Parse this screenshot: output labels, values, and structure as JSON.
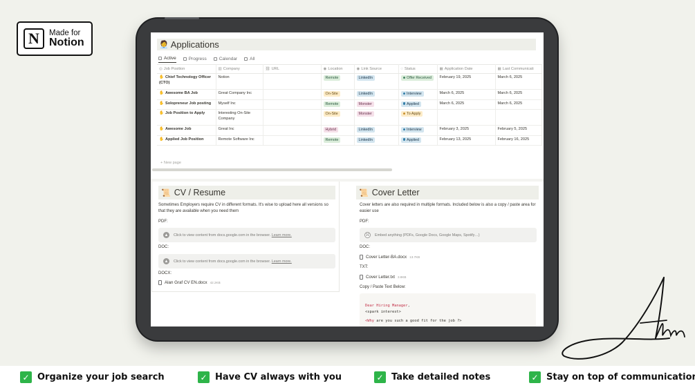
{
  "badge": {
    "line1": "Made for",
    "line2": "Notion",
    "logo_letter": "N"
  },
  "database": {
    "emoji": "🧑‍💼",
    "title": "Applications",
    "views": [
      {
        "label": "Active",
        "icon": "doc-icon",
        "active": true
      },
      {
        "label": "Progress",
        "icon": "board-icon",
        "active": false
      },
      {
        "label": "Calendar",
        "icon": "calendar-icon",
        "active": false
      },
      {
        "label": "All",
        "icon": "list-icon",
        "active": false
      }
    ],
    "columns": [
      "Job Position",
      "Company",
      "URL",
      "Location",
      "Link Source",
      "Status",
      "Application Date",
      "Last Communicati"
    ],
    "rows": [
      {
        "position": "Chief Technology Officer (CTO)",
        "company": "Notion",
        "url": "",
        "location": "Remote",
        "source": "LinkedIn",
        "status": "Offer Received",
        "applied": "February 19, 2025",
        "last": "March 6, 2025"
      },
      {
        "position": "Awesome BA Job",
        "company": "Great Company Inc",
        "url": "",
        "location": "On-Site",
        "source": "LinkedIn",
        "status": "Interview",
        "applied": "March 6, 2025",
        "last": "March 6, 2025"
      },
      {
        "position": "Solopreneur Job posting",
        "company": "Myself Inc",
        "url": "",
        "location": "Remote",
        "source": "Monster",
        "status": "Applied",
        "applied": "March 6, 2025",
        "last": "March 6, 2025"
      },
      {
        "position": "Job Position to Apply",
        "company": "Interesting On-Site Company",
        "url": "",
        "location": "On-Site",
        "source": "Monster",
        "status": "To Apply",
        "applied": "",
        "last": ""
      },
      {
        "position": "Awesome Job",
        "company": "Great Inc",
        "url": "",
        "location": "Hybrid",
        "source": "LinkedIn",
        "status": "Interview",
        "applied": "February 3, 2025",
        "last": "February 5, 2025"
      },
      {
        "position": "Applied Job Position",
        "company": "Remote Software Inc",
        "url": "",
        "location": "Remote",
        "source": "LinkedIn",
        "status": "Applied",
        "applied": "February 13, 2025",
        "last": "February 16, 2025"
      }
    ],
    "new_page": "+ New page"
  },
  "cv": {
    "emoji": "📜",
    "title": "CV / Resume",
    "description": "Sometimes Employers require CV in different formats. It's wise to upload here all versions so that they are available when you need them",
    "pdf_label": "PDF:",
    "doc_label": "DOC:",
    "docx_label": "DOCX:",
    "embed_text": "Click to view content from docs.google.com in the browser.",
    "learn_more": "Learn more.",
    "docx_file": "Alan Graf CV EN.docx",
    "docx_size": "42.2KB"
  },
  "cover": {
    "emoji": "📜",
    "title": "Cover Letter",
    "description": "Cover letters are also required in multiple formats. Included below is also a copy / paste area for easier use",
    "pdf_label": "PDF:",
    "embed_text": "Embed anything (PDFs, Google Docs, Google Maps, Spotify…)",
    "doc_label": "DOC:",
    "doc_file": "Cover Letter-BA.docx",
    "doc_size": "13.7KB",
    "txt_label": "TXT:",
    "txt_file": "Cover Letter.txt",
    "txt_size": "3.8KB",
    "paste_label": "Copy / Paste Text Below:",
    "code_line1_tag": "Dear Hiring Manager",
    "code_line1_rest": ",",
    "code_line2": "<spark interest>",
    "code_line3_tag": "<Why",
    "code_line3_rest": " are you such a good fit for the job ?>"
  },
  "features": [
    {
      "label": "Organize your job search"
    },
    {
      "label": "Have CV always with you"
    },
    {
      "label": "Take detailed notes"
    },
    {
      "label": "Stay on top of communication"
    }
  ],
  "colors": {
    "check": "#2eb449",
    "background": "#f1f2ec",
    "device": "#3a3b3d"
  }
}
